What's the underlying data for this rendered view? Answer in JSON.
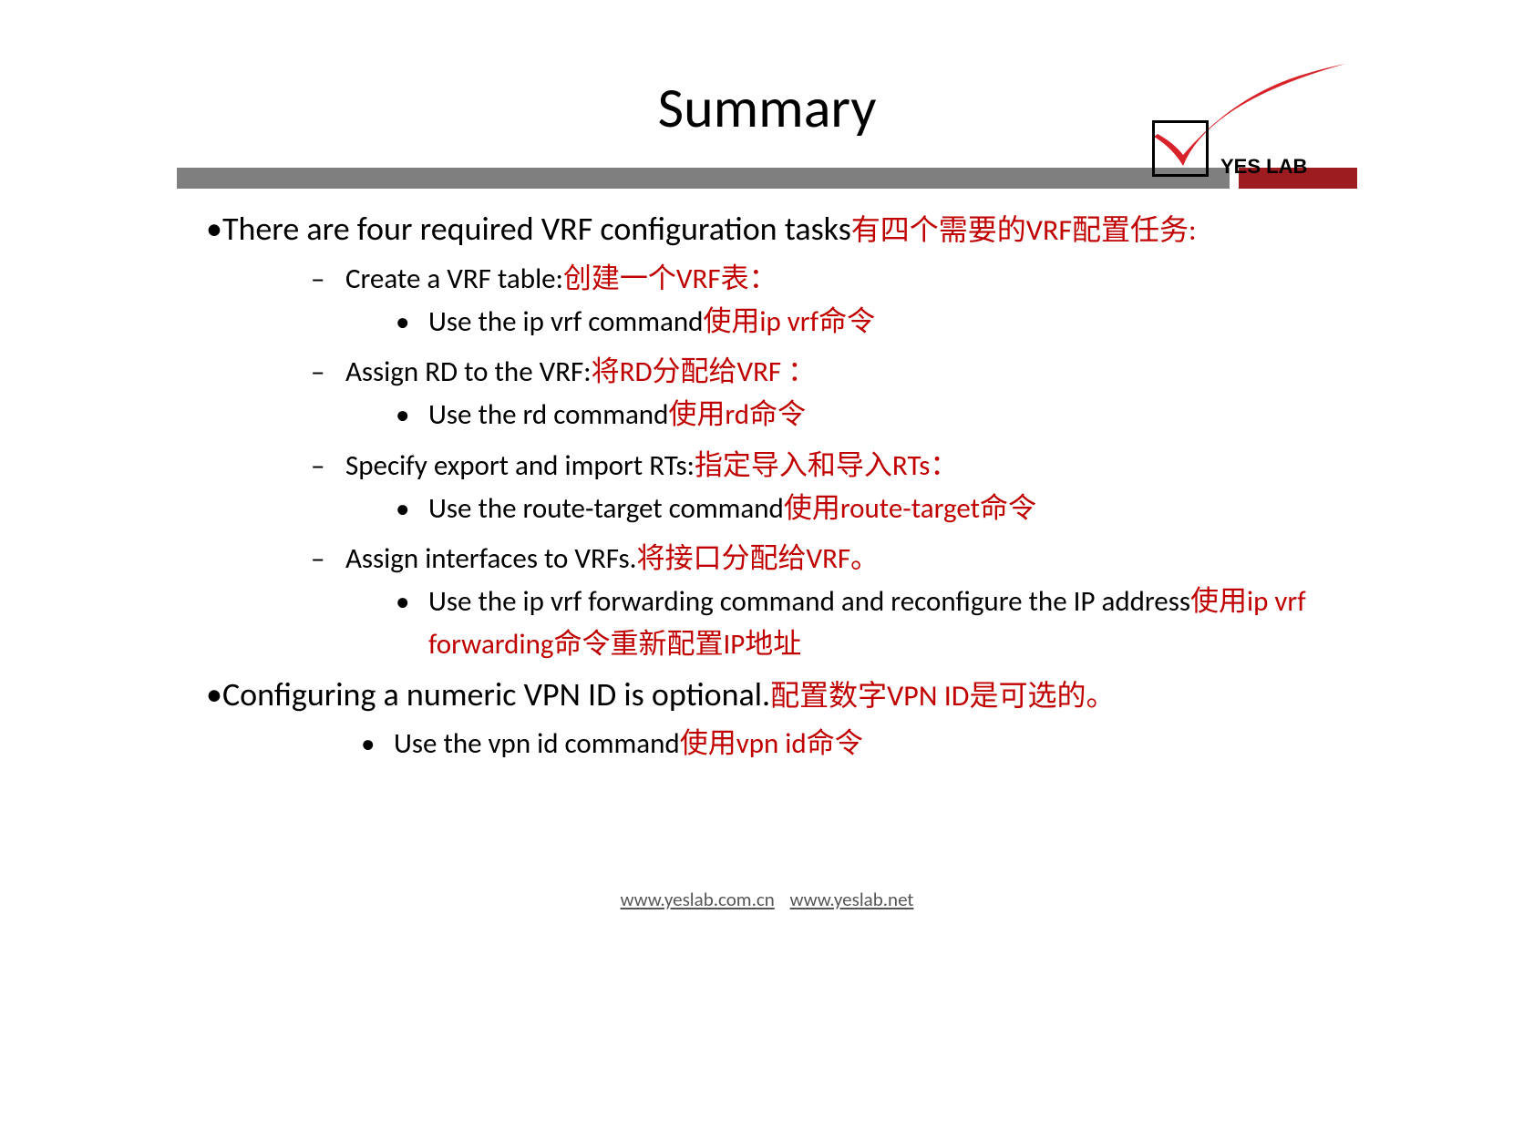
{
  "title": "Summary",
  "logo": {
    "text": "YES LAB"
  },
  "content": {
    "main1": {
      "en": "There are four required VRF configuration tasks",
      "zh": "有四个需要的VRF配置任务:"
    },
    "items": [
      {
        "en": "Create a VRF table:",
        "zh": "创建一个VRF表：",
        "sub": {
          "en": "Use the ip vrf command",
          "zh": "使用ip vrf命令"
        }
      },
      {
        "en": "Assign RD to the VRF:",
        "zh": "将RD分配给VRF ：",
        "sub": {
          "en": "Use the rd command",
          "zh": "使用rd命令"
        }
      },
      {
        "en": "Specify export and import RTs:",
        "zh": "指定导入和导入RTs：",
        "sub": {
          "en": "Use the route-target command",
          "zh": "使用route-target命令"
        }
      },
      {
        "en": "Assign interfaces to VRFs.",
        "zh": "将接口分配给VRF。",
        "sub": {
          "en": "Use the ip vrf forwarding command and reconfigure the IP  address",
          "zh": "使用ip vrf forwarding命令重新配置IP地址"
        }
      }
    ],
    "main2": {
      "en": "Configuring a numeric VPN ID is optional.",
      "zh": "配置数字VPN ID是可选的。"
    },
    "main2_sub": {
      "en": "Use the vpn id command",
      "zh": "使用vpn id命令"
    }
  },
  "footer": {
    "link1": "www.yeslab.com.cn",
    "link2": "www.yeslab.net"
  }
}
